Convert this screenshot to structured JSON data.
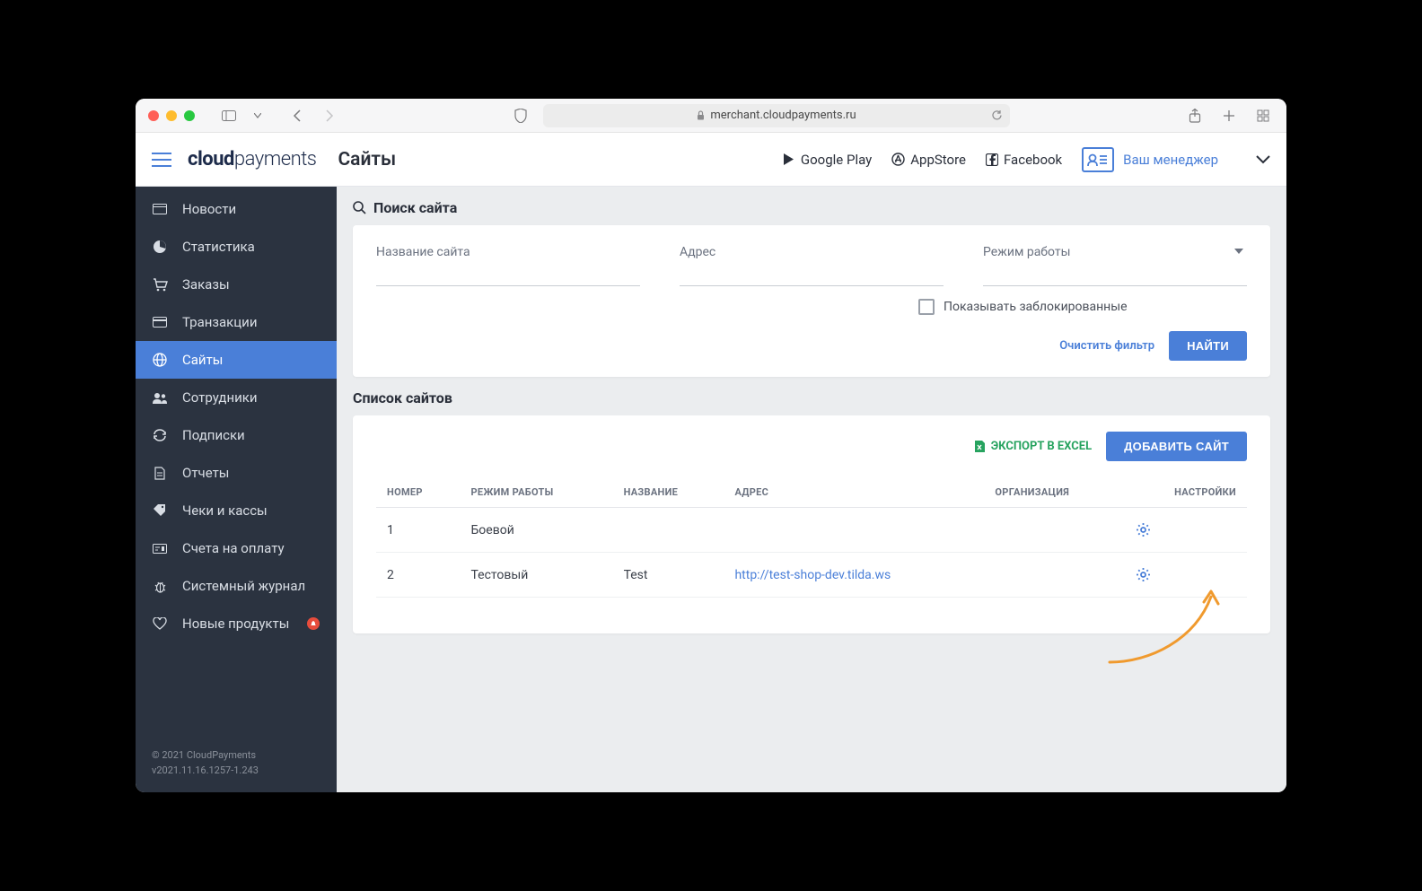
{
  "browser": {
    "url": "merchant.cloudpayments.ru"
  },
  "header": {
    "logo_bold": "cloud",
    "logo_light": "payments",
    "page_title": "Сайты",
    "links": {
      "google_play": "Google Play",
      "appstore": "AppStore",
      "facebook": "Facebook"
    },
    "manager_label": "Ваш менеджер"
  },
  "sidebar": {
    "items": [
      {
        "label": "Новости"
      },
      {
        "label": "Статистика"
      },
      {
        "label": "Заказы"
      },
      {
        "label": "Транзакции"
      },
      {
        "label": "Сайты"
      },
      {
        "label": "Сотрудники"
      },
      {
        "label": "Подписки"
      },
      {
        "label": "Отчеты"
      },
      {
        "label": "Чеки и кассы"
      },
      {
        "label": "Счета на оплату"
      },
      {
        "label": "Системный журнал"
      },
      {
        "label": "Новые продукты"
      }
    ],
    "footer_copyright": "© 2021 CloudPayments",
    "footer_version": "v2021.11.16.1257-1.243"
  },
  "search": {
    "section_title": "Поиск сайта",
    "name_label": "Название сайта",
    "address_label": "Адрес",
    "mode_label": "Режим работы",
    "show_blocked": "Показывать заблокированные",
    "clear_filter": "Очистить фильтр",
    "find_button": "НАЙТИ"
  },
  "list": {
    "section_title": "Список сайтов",
    "export_label": "ЭКСПОРТ В EXCEL",
    "add_button": "ДОБАВИТЬ САЙТ",
    "columns": {
      "number": "НОМЕР",
      "mode": "РЕЖИМ РАБОТЫ",
      "name": "НАЗВАНИЕ",
      "address": "АДРЕС",
      "org": "ОРГАНИЗАЦИЯ",
      "settings": "НАСТРОЙКИ"
    },
    "rows": [
      {
        "number": "1",
        "mode": "Боевой",
        "name": "",
        "address": "",
        "org": ""
      },
      {
        "number": "2",
        "mode": "Тестовый",
        "name": "Test",
        "address": "http://test-shop-dev.tilda.ws",
        "org": ""
      }
    ]
  }
}
